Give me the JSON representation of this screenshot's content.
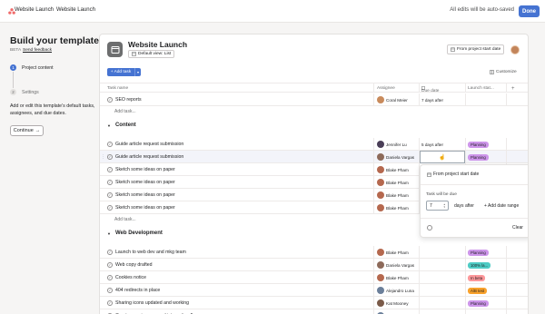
{
  "topbar": {
    "breadcrumb_1": "Website Launch",
    "breadcrumb_sep": "›",
    "breadcrumb_2": "Website Launch",
    "autosave": "All edits will be auto-saved",
    "done": "Done"
  },
  "left": {
    "title": "Build your template",
    "beta": "BETA",
    "feedback": "Send feedback",
    "step1_num": "1",
    "step1_label": "Project content",
    "step2_num": "2",
    "step2_label": "Settings",
    "description": "Add or edit this template's default tasks, assignees, and due dates.",
    "continue": "Continue",
    "continue_arrow": "→"
  },
  "project": {
    "title": "Website Launch",
    "view": "Default view: List",
    "from_start": "From project start date",
    "add_task": "Add task",
    "customize": "Customize"
  },
  "columns": {
    "task_name": "Task name",
    "assignee": "Assignee",
    "due_date": "Due date",
    "launch_status": "Launch stat...",
    "add": "+"
  },
  "rows_top": [
    {
      "task": "SEO reports",
      "assignee": "Coral Meier",
      "due": "7 days after",
      "status": "",
      "av_color": "#c98b5c"
    }
  ],
  "add_task_label": "Add task...",
  "sections": [
    {
      "name": "Content"
    },
    {
      "name": "Web Development"
    }
  ],
  "rows_content": [
    {
      "task": "Guide article request submission",
      "assignee": "Jennifer Lu",
      "due": "5 days after",
      "status": "Planning",
      "av_color": "#4a3e57"
    },
    {
      "task": "Guide article request submission",
      "assignee": "Daniela Vargas",
      "due": "",
      "status": "Planning",
      "av_color": "#8d6a5a"
    },
    {
      "task": "Sketch some ideas on paper",
      "assignee": "Blake Pham",
      "due": "",
      "status": "",
      "av_color": "#b5684e"
    },
    {
      "task": "Sketch some ideas on paper",
      "assignee": "Blake Pham",
      "due": "",
      "status": "",
      "av_color": "#b5684e"
    },
    {
      "task": "Sketch some ideas on paper",
      "assignee": "Blake Pham",
      "due": "",
      "status": "",
      "av_color": "#b5684e"
    },
    {
      "task": "Sketch some ideas on paper",
      "assignee": "Blake Pham",
      "due": "",
      "status": "",
      "av_color": "#b5684e"
    }
  ],
  "rows_web": [
    {
      "task": "Launch to web dev and mkg team",
      "assignee": "Blake Pham",
      "due": "",
      "status": "Planning",
      "av_color": "#b5684e"
    },
    {
      "task": "Web copy drafted",
      "assignee": "Daniela Vargas",
      "due": "",
      "status": "100% la...",
      "av_color": "#8d6a5a"
    },
    {
      "task": "Cookies notice",
      "assignee": "Blake Pham",
      "due": "",
      "status": "In beta",
      "av_color": "#b5684e"
    },
    {
      "task": "404 redirects in place",
      "assignee": "Alejandro Luna",
      "due": "",
      "status": "A/B test",
      "av_color": "#6b7f9a"
    },
    {
      "task": "Sharing icons updated and working",
      "assignee": "Kat Mooney",
      "due": "",
      "status": "Planning",
      "av_color": "#7a5a48"
    },
    {
      "task": "Create user journey and interaction flows",
      "assignee": "Alejandro Luna",
      "due": "",
      "status": "",
      "av_color": "#6b7f9a"
    }
  ],
  "status_colors": {
    "Planning": {
      "bg": "#cd95ea",
      "fg": "#1e1f21"
    },
    "100% la...": {
      "bg": "#4ecbc4",
      "fg": "#1e1f21"
    },
    "In beta": {
      "bg": "#fc979a",
      "fg": "#1e1f21"
    },
    "A/B test": {
      "bg": "#f8a12b",
      "fg": "#1e1f21"
    }
  },
  "popover": {
    "from_start": "From project start date",
    "task_will_be_due": "Task will be due",
    "value": "7",
    "days_after": "days after",
    "add_date_range": "+ Add date range",
    "clear": "Clear"
  },
  "accent": "#4573d2"
}
